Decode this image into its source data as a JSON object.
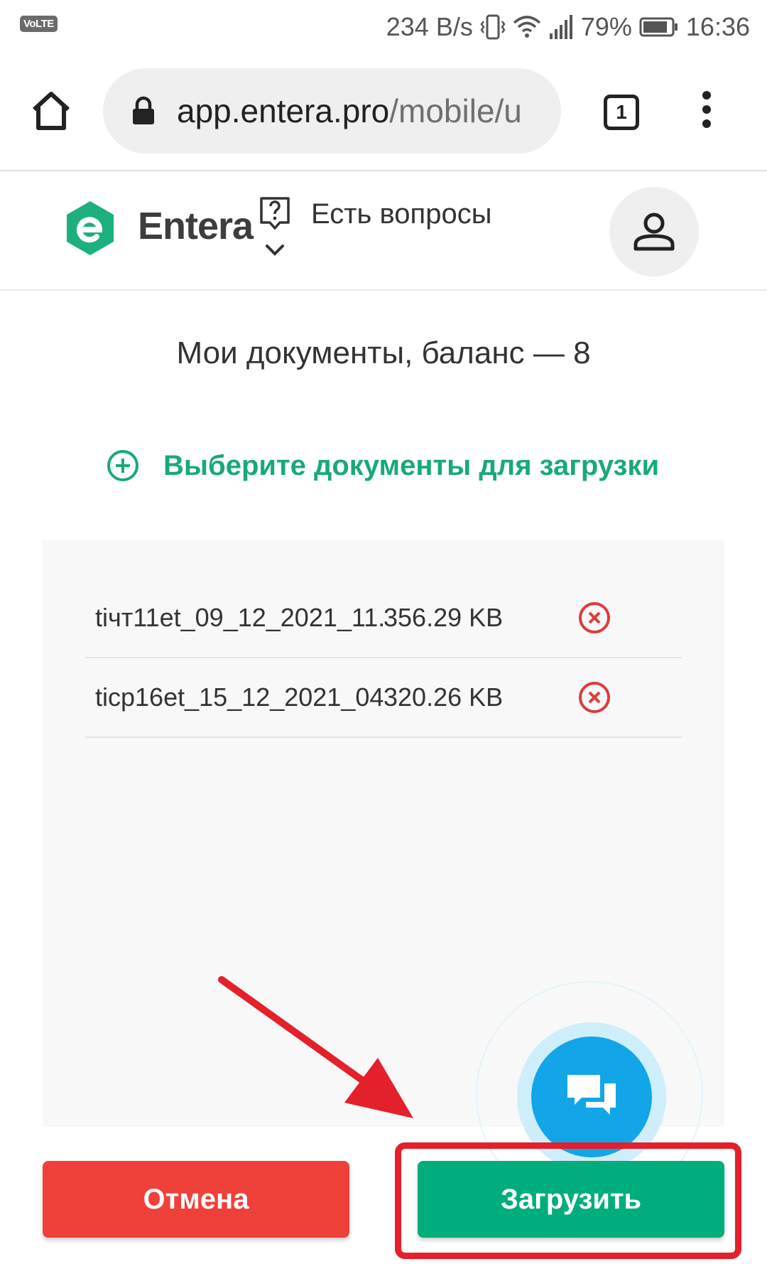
{
  "status_bar": {
    "volte": "VoLTE",
    "net_speed": "234 B/s",
    "battery": "79%",
    "time": "16:36"
  },
  "browser": {
    "url_host": "app.entera.pro",
    "url_path": "/mobile/u",
    "tab_count": "1"
  },
  "header": {
    "brand": "Entera",
    "help_label": "Есть вопросы"
  },
  "main": {
    "title": "Мои документы, баланс — 8",
    "choose_label": "Выберите документы для загрузки",
    "files": [
      {
        "name": "tiчт11et_09_12_2021_11...",
        "size": "356.29 KB"
      },
      {
        "name": "ticp16et_15_12_2021_04...",
        "size": "320.26 KB"
      }
    ]
  },
  "actions": {
    "cancel": "Отмена",
    "upload": "Загрузить"
  },
  "colors": {
    "accent_green": "#19a979",
    "cancel_red": "#f0403a",
    "upload_green": "#00ad7c",
    "chat_blue": "#12a6e8",
    "annotation_red": "#e4202b"
  }
}
